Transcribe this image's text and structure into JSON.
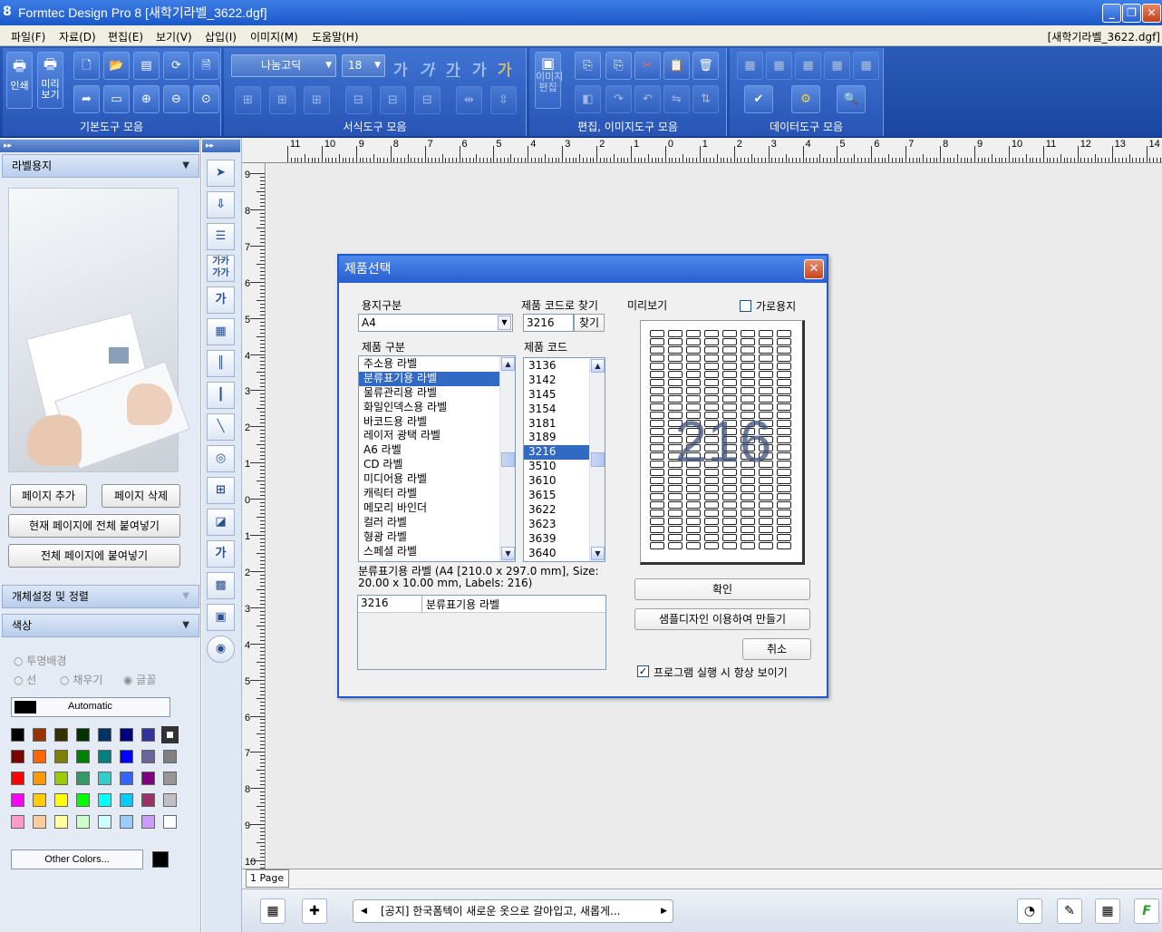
{
  "app": {
    "title": "Formtec Design Pro 8 [새학기라벨_3622.dgf]",
    "doc_name": "[새학기라벨_3622.dgf]"
  },
  "menu": [
    "파일(F)",
    "자료(D)",
    "편집(E)",
    "보기(V)",
    "삽입(I)",
    "이미지(M)",
    "도움말(H)"
  ],
  "ribbon": {
    "groups": [
      "기본도구 모음",
      "서식도구 모음",
      "편집, 이미지도구 모음",
      "데이터도구 모음"
    ],
    "print": "인쇄",
    "preview": "미리\n보기",
    "image_edit": "이미지\n편집",
    "font": "나눔고딕",
    "font_size": "18",
    "ga": "가"
  },
  "left_panel": {
    "header": "라벨용지",
    "add_page": "페이지 추가",
    "del_page": "페이지 삭제",
    "paste_current": "현재 페이지에 전체 붙여넣기",
    "paste_all": "전체 페이지에 붙여넣기",
    "object_header": "개체설정 및 정렬",
    "color_header": "색상",
    "radio_transparent": "투명배경",
    "radio_line": "선",
    "radio_fill": "채우기",
    "radio_text": "글꼴",
    "automatic": "Automatic",
    "other_colors": "Other Colors..."
  },
  "palette": [
    [
      "#000000",
      "#993300",
      "#333300",
      "#003300",
      "#003366",
      "#000080",
      "#333399",
      "#333333"
    ],
    [
      "#800000",
      "#ff6600",
      "#808000",
      "#008000",
      "#008080",
      "#0000ff",
      "#666699",
      "#808080"
    ],
    [
      "#ff0000",
      "#ff9900",
      "#99cc00",
      "#339966",
      "#33cccc",
      "#3366ff",
      "#800080",
      "#969696"
    ],
    [
      "#ff00ff",
      "#ffcc00",
      "#ffff00",
      "#00ff00",
      "#00ffff",
      "#00ccff",
      "#993366",
      "#c0c0c0"
    ],
    [
      "#ff99cc",
      "#ffcc99",
      "#ffff99",
      "#ccffcc",
      "#ccffff",
      "#99ccff",
      "#cc99ff",
      "#ffffff"
    ]
  ],
  "rulers": {
    "h": [
      "11",
      "10",
      "9",
      "8",
      "7",
      "6",
      "5",
      "4",
      "3",
      "2",
      "1",
      "0",
      "1",
      "2",
      "3",
      "4",
      "5",
      "6",
      "7",
      "8",
      "9",
      "10",
      "11",
      "12",
      "13",
      "14"
    ],
    "v": [
      "9",
      "8",
      "7",
      "6",
      "5",
      "4",
      "3",
      "2",
      "1",
      "0",
      "1",
      "2",
      "3",
      "4",
      "5",
      "6",
      "7",
      "8",
      "9",
      "10"
    ]
  },
  "page_tab": "1 Page",
  "status": {
    "notice": "[공지] 한국폼텍이 새로운 옷으로 갈아입고, 새롭게..."
  },
  "dialog": {
    "title": "제품선택",
    "paper_label": "용지구분",
    "paper_value": "A4",
    "code_find_label": "제품 코드로 찾기",
    "code_value": "3216",
    "find_btn": "찾기",
    "preview_label": "미리보기",
    "landscape": "가로용지",
    "category_label": "제품 구분",
    "code_label": "제품 코드",
    "categories": [
      "주소용 라벨",
      "분류표기용 라벨",
      "물류관리용 라벨",
      "화일인덱스용 라벨",
      "바코드용 라벨",
      "레이저 광택 라벨",
      "A6 라벨",
      "CD 라벨",
      "미디어용 라벨",
      "캐릭터 라벨",
      "메모리 바인더",
      "컬러 라벨",
      "형광 라벨",
      "스페셜 라벨"
    ],
    "selected_category": 1,
    "codes": [
      "3136",
      "3142",
      "3145",
      "3154",
      "3181",
      "3189",
      "3216",
      "3510",
      "3610",
      "3615",
      "3622",
      "3623",
      "3639",
      "3640"
    ],
    "selected_code": 6,
    "info": "분류표기용 라벨 (A4 [210.0 x 297.0 mm], Size: 20.00 x 10.00 mm, Labels: 216)",
    "result_code": "3216",
    "result_name": "분류표기용 라벨",
    "preview_count": "216",
    "ok": "확인",
    "sample": "샘플디자인 이용하여 만들기",
    "cancel": "취소",
    "always_show": "프로그램 실행 시 항상 보이기"
  }
}
